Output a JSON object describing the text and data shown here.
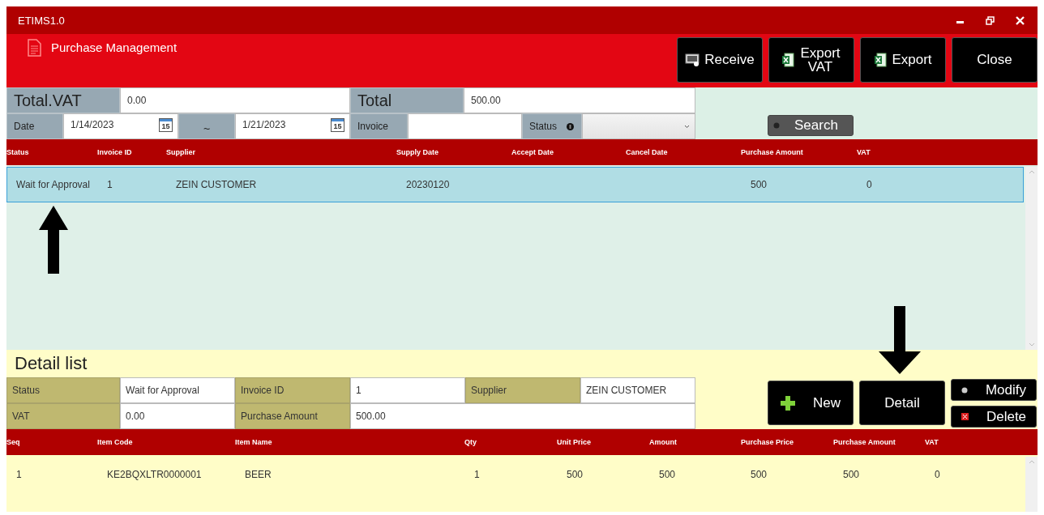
{
  "window": {
    "title": "ETIMS1.0"
  },
  "header": {
    "title": "Purchase Management",
    "buttons": [
      {
        "label": "Receive",
        "kind": "receive"
      },
      {
        "label": "Export VAT",
        "kind": "excel"
      },
      {
        "label": "Export",
        "kind": "excel"
      },
      {
        "label": "Close",
        "kind": "plain"
      }
    ]
  },
  "summary": [
    {
      "label": "Total.VAT",
      "value": "0.00"
    },
    {
      "label": "Total",
      "value": "500.00"
    }
  ],
  "filters": {
    "date_label": "Date",
    "dates": [
      {
        "value": "1/14/2023",
        "calendar_day": "15"
      },
      {
        "value": "1/21/2023",
        "calendar_day": "15"
      }
    ],
    "separator": "~",
    "invoice_label": "Invoice",
    "status_label": "Status",
    "search_button": "Search"
  },
  "purchase_table": {
    "columns": [
      "Status",
      "Invoice ID",
      "Supplier",
      "Supply Date",
      "Accept Date",
      "Cancel Date",
      "Purchase Amount",
      "VAT"
    ],
    "rows": [
      {
        "selected": true,
        "cells": [
          "Wait for Approval",
          "1",
          "ZEIN CUSTOMER",
          "20230120",
          null,
          null,
          "500",
          "0"
        ]
      }
    ]
  },
  "detail": {
    "title": "Detail list",
    "fields": [
      [
        {
          "label": "Status",
          "value": "Wait for Approval"
        },
        {
          "label": "Invoice ID",
          "value": "1"
        },
        {
          "label": "Supplier",
          "value": "ZEIN CUSTOMER"
        }
      ],
      [
        {
          "label": "VAT",
          "value": "0.00"
        },
        {
          "label": "Purchase Amount",
          "value": "500.00"
        }
      ]
    ],
    "buttons": [
      {
        "label": "New",
        "kind": "new"
      },
      {
        "label": "Detail",
        "kind": "plain"
      },
      {
        "label": "Modify",
        "kind": "modify"
      },
      {
        "label": "Delete",
        "kind": "delete"
      }
    ]
  },
  "detail_table": {
    "columns": [
      "Seq",
      "Item Code",
      "Item Name",
      "Qty",
      "Unit Price",
      "Amount",
      "Purchase Price",
      "Purchase Amount",
      "VAT"
    ],
    "rows": [
      {
        "selected": false,
        "cells": [
          "1",
          "KE2BQXLTR0000001",
          "BEER",
          "1",
          "500",
          "500",
          "500",
          "500",
          "0"
        ]
      }
    ]
  },
  "annotations": [
    {
      "kind": "up"
    },
    {
      "kind": "down"
    }
  ]
}
